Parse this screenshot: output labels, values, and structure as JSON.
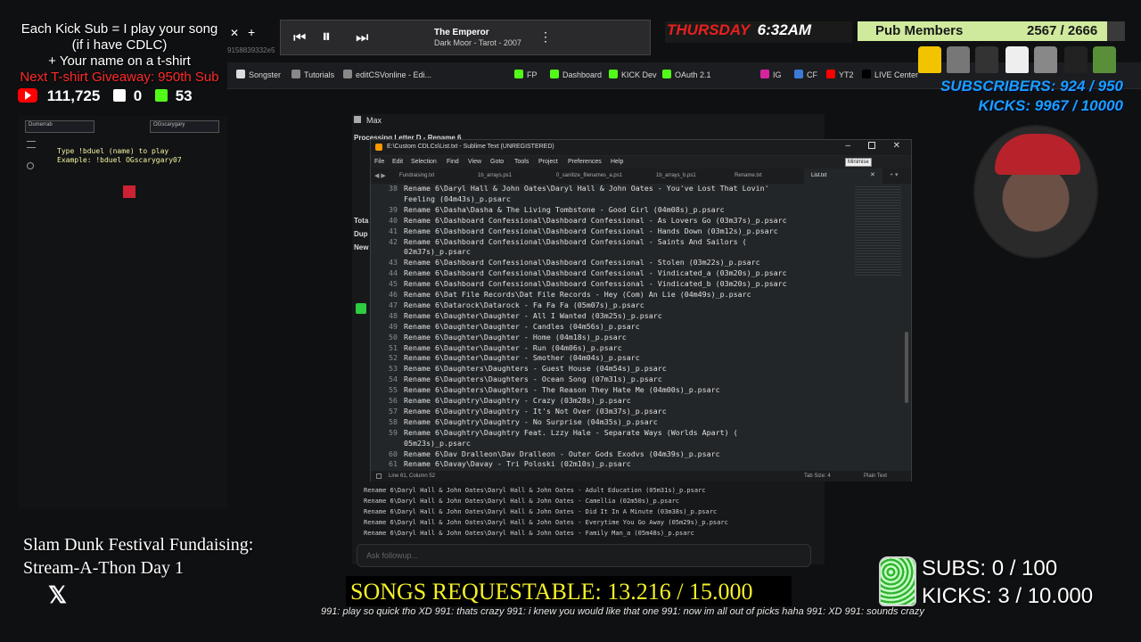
{
  "overlay": {
    "promo_line1": "Each Kick Sub = I play your song",
    "promo_line2": "(if i have CDLC)",
    "promo_line3": "+ Your name on a t-shirt",
    "promo_line4": "Next T-shirt Giveaway: 950th Sub",
    "youtube_subs": "111,725",
    "twitch_count": "0",
    "kick_count": "53",
    "day": "THURSDAY",
    "time": "6:32AM",
    "pub_members_label": "Pub Members",
    "pub_members_count": "2567 / 2666",
    "subscribers": "SUBSCRIBERS: 924 / 950",
    "kicks": "KICKS: 9967 / 10000",
    "slam_line1": "Slam Dunk Festival Fundaising:",
    "slam_line2": "Stream-A-Thon Day 1",
    "songs_requestable": "SONGS REQUESTABLE: 13.216 / 15.000",
    "subs_goal": "SUBS:  0 / 100",
    "kicks_goal": "KICKS: 3 / 10.000",
    "ticker": "991: play so quick tho XD 991: thats crazy 991: i knew you would like that one 991: now im all out of picks haha 991: XD 991: sounds crazy"
  },
  "player": {
    "song_title": "The Emperor",
    "song_meta": "Dark Moor - Tarot - 2007"
  },
  "browser": {
    "address_fragment": "9158839332e5",
    "bookmarks": [
      "Songster",
      "Tutorials",
      "editCSVonline - Edi...",
      "FP",
      "Dashboard",
      "KICK Dev",
      "OAuth 2.1",
      "IG",
      "CF",
      "YT2",
      "LIVE Center"
    ]
  },
  "left_panel": {
    "duel_line1": "Type !bduel (name) to play",
    "duel_line2": "Example: !bduel OGscarygary07",
    "card1": "Dumerrab",
    "card2": "OGscarygary"
  },
  "background_app": {
    "user": "Max",
    "processing": "Processing Letter D - Rename 6",
    "side_labels": [
      "Tota",
      "Dup",
      "New"
    ],
    "lines": [
      "Rename 6\\Daryl Hall & John Oates\\Daryl Hall & John Oates - Adult Education (05m31s)_p.psarc",
      "Rename 6\\Daryl Hall & John Oates\\Daryl Hall & John Oates - Camellia (02m50s)_p.psarc",
      "Rename 6\\Daryl Hall & John Oates\\Daryl Hall & John Oates - Did It In A Minute (03m38s)_p.psarc",
      "Rename 6\\Daryl Hall & John Oates\\Daryl Hall & John Oates - Everytime You Go Away (05m29s)_p.psarc",
      "Rename 6\\Daryl Hall & John Oates\\Daryl Hall & John Oates - Family Man_a (05m48s)_p.psarc"
    ],
    "ask_placeholder": "Ask followup..."
  },
  "sublime": {
    "title": "E:\\Custom CDLCs\\List.txt - Sublime Text (UNREGISTERED)",
    "menu": [
      "File",
      "Edit",
      "Selection",
      "Find",
      "View",
      "Goto",
      "Tools",
      "Project",
      "Preferences",
      "Help"
    ],
    "tabs": [
      "Fundraising.txt",
      "1b_arrays.ps1",
      "0_sanitize_filenames_a.ps1",
      "1b_arrays_b.ps1",
      "Rename.txt",
      "List.txt"
    ],
    "active_tab": "List.txt",
    "tooltip": "Minimise",
    "status_left": "Line 61, Column 52",
    "status_tab": "Tab Size: 4",
    "status_syntax": "Plain Text",
    "code_lines": [
      {
        "n": "38",
        "t": "Rename 6\\Daryl Hall & John Oates\\Daryl Hall & John Oates - You've Lost That Lovin'"
      },
      {
        "n": "",
        "t": "Feeling (04m43s)_p.psarc"
      },
      {
        "n": "39",
        "t": "Rename 6\\Dasha\\Dasha & The Living Tombstone - Good Girl (04m08s)_p.psarc"
      },
      {
        "n": "40",
        "t": "Rename 6\\Dashboard Confessional\\Dashboard Confessional - As Lovers Go (03m37s)_p.psarc"
      },
      {
        "n": "41",
        "t": "Rename 6\\Dashboard Confessional\\Dashboard Confessional - Hands Down (03m12s)_p.psarc"
      },
      {
        "n": "42",
        "t": "Rename 6\\Dashboard Confessional\\Dashboard Confessional - Saints And Sailors ("
      },
      {
        "n": "",
        "t": "02m37s)_p.psarc"
      },
      {
        "n": "43",
        "t": "Rename 6\\Dashboard Confessional\\Dashboard Confessional - Stolen (03m22s)_p.psarc"
      },
      {
        "n": "44",
        "t": "Rename 6\\Dashboard Confessional\\Dashboard Confessional - Vindicated_a (03m20s)_p.psarc"
      },
      {
        "n": "45",
        "t": "Rename 6\\Dashboard Confessional\\Dashboard Confessional - Vindicated_b (03m20s)_p.psarc"
      },
      {
        "n": "46",
        "t": "Rename 6\\Dat File Records\\Dat File Records - Hey (Com) An Lie (04m49s)_p.psarc"
      },
      {
        "n": "47",
        "t": "Rename 6\\Datarock\\Datarock - Fa Fa Fa (05m07s)_p.psarc"
      },
      {
        "n": "48",
        "t": "Rename 6\\Daughter\\Daughter - All I Wanted (03m25s)_p.psarc"
      },
      {
        "n": "49",
        "t": "Rename 6\\Daughter\\Daughter - Candles (04m56s)_p.psarc"
      },
      {
        "n": "50",
        "t": "Rename 6\\Daughter\\Daughter - Home (04m18s)_p.psarc"
      },
      {
        "n": "51",
        "t": "Rename 6\\Daughter\\Daughter - Run (04m06s)_p.psarc"
      },
      {
        "n": "52",
        "t": "Rename 6\\Daughter\\Daughter - Smother (04m04s)_p.psarc"
      },
      {
        "n": "53",
        "t": "Rename 6\\Daughters\\Daughters - Guest House (04m54s)_p.psarc"
      },
      {
        "n": "54",
        "t": "Rename 6\\Daughters\\Daughters - Ocean Song (07m31s)_p.psarc"
      },
      {
        "n": "55",
        "t": "Rename 6\\Daughters\\Daughters - The Reason They Hate Me (04m00s)_p.psarc"
      },
      {
        "n": "56",
        "t": "Rename 6\\Daughtry\\Daughtry - Crazy (03m28s)_p.psarc"
      },
      {
        "n": "57",
        "t": "Rename 6\\Daughtry\\Daughtry - It's Not Over (03m37s)_p.psarc"
      },
      {
        "n": "58",
        "t": "Rename 6\\Daughtry\\Daughtry - No Surprise (04m35s)_p.psarc"
      },
      {
        "n": "59",
        "t": "Rename 6\\Daughtry\\Daughtry Feat. Lzzy Hale - Separate Ways (Worlds Apart) ("
      },
      {
        "n": "",
        "t": "05m23s)_p.psarc"
      },
      {
        "n": "60",
        "t": "Rename 6\\Dav Dralleon\\Dav Dralleon - Outer Gods Exodvs (04m39s)_p.psarc"
      },
      {
        "n": "61",
        "t": "Rename 6\\Davay\\Davay - Tri Poloski (02m10s)_p.psarc"
      }
    ]
  },
  "colors": {
    "green_screen": "#10ff10",
    "accent_yellow": "#f4f028",
    "accent_red": "#ff2a2a",
    "kick_green": "#53fc18"
  }
}
